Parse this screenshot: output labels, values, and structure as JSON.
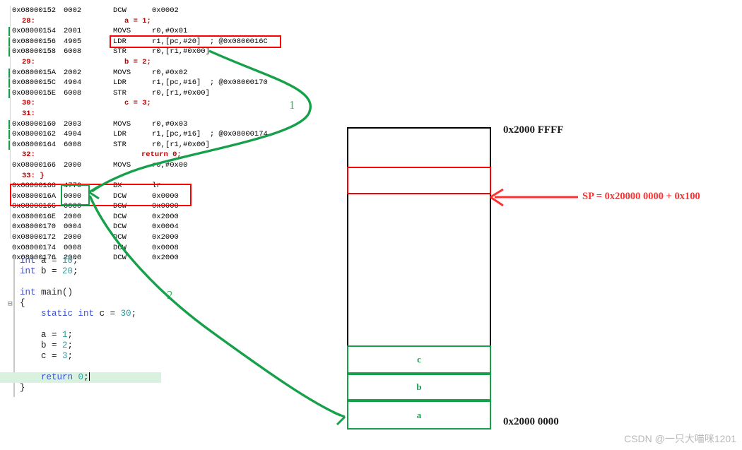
{
  "disassembly": {
    "rows": [
      {
        "kind": "asm",
        "addr": "0x08000152",
        "code": "0002",
        "mnem": "DCW",
        "oper": "0x0002",
        "marker": false
      },
      {
        "kind": "src",
        "lineno": "28:",
        "text": "a = 1;"
      },
      {
        "kind": "asm",
        "addr": "0x08000154",
        "code": "2001",
        "mnem": "MOVS",
        "oper": "r0,#0x01",
        "marker": true
      },
      {
        "kind": "asm",
        "addr": "0x08000156",
        "code": "4905",
        "mnem": "LDR",
        "oper": "r1,[pc,#20]  ; @0x0800016C",
        "marker": true
      },
      {
        "kind": "asm",
        "addr": "0x08000158",
        "code": "6008",
        "mnem": "STR",
        "oper": "r0,[r1,#0x00]",
        "marker": true
      },
      {
        "kind": "src",
        "lineno": "29:",
        "text": "b = 2;"
      },
      {
        "kind": "asm",
        "addr": "0x0800015A",
        "code": "2002",
        "mnem": "MOVS",
        "oper": "r0,#0x02",
        "marker": true
      },
      {
        "kind": "asm",
        "addr": "0x0800015C",
        "code": "4904",
        "mnem": "LDR",
        "oper": "r1,[pc,#16]  ; @0x08000170",
        "marker": true
      },
      {
        "kind": "asm",
        "addr": "0x0800015E",
        "code": "6008",
        "mnem": "STR",
        "oper": "r0,[r1,#0x00]",
        "marker": true
      },
      {
        "kind": "src",
        "lineno": "30:",
        "text": "c = 3;"
      },
      {
        "kind": "src",
        "lineno": "31:",
        "text": ""
      },
      {
        "kind": "asm",
        "addr": "0x08000160",
        "code": "2003",
        "mnem": "MOVS",
        "oper": "r0,#0x03",
        "marker": true
      },
      {
        "kind": "asm",
        "addr": "0x08000162",
        "code": "4904",
        "mnem": "LDR",
        "oper": "r1,[pc,#16]  ; @0x08000174",
        "marker": true
      },
      {
        "kind": "asm",
        "addr": "0x08000164",
        "code": "6008",
        "mnem": "STR",
        "oper": "r0,[r1,#0x00]",
        "marker": true
      },
      {
        "kind": "src",
        "lineno": "32:",
        "text": "return 0;",
        "indent": true
      },
      {
        "kind": "asm",
        "addr": "0x08000166",
        "code": "2000",
        "mnem": "MOVS",
        "oper": "r0,#0x00",
        "marker": false
      },
      {
        "kind": "src",
        "lineno": "33: }",
        "text": ""
      },
      {
        "kind": "asm",
        "addr": "0x08000168",
        "code": "4770",
        "mnem": "BX",
        "oper": "lr",
        "marker": false
      },
      {
        "kind": "asm",
        "addr": "0x0800016A",
        "code": "0000",
        "mnem": "DCW",
        "oper": "0x0000",
        "marker": false
      },
      {
        "kind": "asm",
        "addr": "0x0800016C",
        "code": "0000",
        "mnem": "DCW",
        "oper": "0x0000",
        "marker": false
      },
      {
        "kind": "asm",
        "addr": "0x0800016E",
        "code": "2000",
        "mnem": "DCW",
        "oper": "0x2000",
        "marker": false
      },
      {
        "kind": "asm",
        "addr": "0x08000170",
        "code": "0004",
        "mnem": "DCW",
        "oper": "0x0004",
        "marker": false
      },
      {
        "kind": "asm",
        "addr": "0x08000172",
        "code": "2000",
        "mnem": "DCW",
        "oper": "0x2000",
        "marker": false
      },
      {
        "kind": "asm",
        "addr": "0x08000174",
        "code": "0008",
        "mnem": "DCW",
        "oper": "0x0008",
        "marker": false
      },
      {
        "kind": "asm",
        "addr": "0x08000176",
        "code": "2000",
        "mnem": "DCW",
        "oper": "0x2000",
        "marker": false
      }
    ]
  },
  "source_code": {
    "lines": [
      {
        "id": "line-int-a",
        "text": "int a = 10;"
      },
      {
        "id": "line-int-b",
        "text": "int b = 20;"
      },
      {
        "id": "line-blank-1",
        "text": ""
      },
      {
        "id": "line-main",
        "text": "int main()"
      },
      {
        "id": "line-brace-open",
        "text": "{"
      },
      {
        "id": "line-static-c",
        "text": "    static int c = 30;"
      },
      {
        "id": "line-blank-2",
        "text": ""
      },
      {
        "id": "line-assign-a",
        "text": "    a = 1;"
      },
      {
        "id": "line-assign-b",
        "text": "    b = 2;"
      },
      {
        "id": "line-assign-c",
        "text": "    c = 3;"
      },
      {
        "id": "line-blank-3",
        "text": ""
      },
      {
        "id": "line-return",
        "text": "    return 0;"
      },
      {
        "id": "line-brace-close",
        "text": "}"
      }
    ]
  },
  "memory_diagram": {
    "top_address_label": "0x2000 FFFF",
    "bottom_address_label": "0x2000 0000",
    "sp_label": "SP = 0x20000 0000 + 0x100",
    "segments": [
      {
        "name": "unused-top",
        "label": "",
        "color": "#000000"
      },
      {
        "name": "stack-region",
        "label": "",
        "color": "#ff0000"
      },
      {
        "name": "free-region",
        "label": "",
        "color": "#000000"
      },
      {
        "name": "static-c",
        "label": "c",
        "color": "#15a049"
      },
      {
        "name": "global-b",
        "label": "b",
        "color": "#15a049"
      },
      {
        "name": "global-a",
        "label": "a",
        "color": "#15a049"
      }
    ]
  },
  "annotations": {
    "arrow_1_label": "1",
    "arrow_2_label": "2",
    "red_highlight_color": "#ff0000",
    "green_highlight_color": "#15a049"
  },
  "watermark": {
    "text": "CSDN @一只大喵咪1201"
  }
}
